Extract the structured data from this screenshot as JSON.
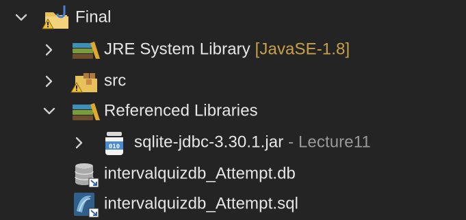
{
  "tree": {
    "project": {
      "label": "Final",
      "icon": "java-project-warning-icon",
      "expanded": true
    },
    "children": [
      {
        "label": "JRE System Library",
        "decoration": "[JavaSE-1.8]",
        "icon": "library-icon",
        "expanded": false
      },
      {
        "label": "src",
        "icon": "package-folder-warning-icon",
        "expanded": false
      },
      {
        "label": "Referenced Libraries",
        "icon": "library-icon",
        "expanded": true,
        "children": [
          {
            "label": "sqlite-jdbc-3.30.1.jar",
            "decoration": "- Lecture11",
            "icon": "jar-icon",
            "expanded": false
          }
        ]
      },
      {
        "label": "intervalquizdb_Attempt.db",
        "icon": "database-file-link-icon"
      },
      {
        "label": "intervalquizdb_Attempt.sql",
        "icon": "sql-file-link-icon"
      }
    ]
  },
  "colors": {
    "background": "#242424",
    "text": "#e6e6e6",
    "decoration_amber": "#c9a04a",
    "decoration_gray": "#9a9a9a",
    "chevron": "#cfcfcf"
  }
}
